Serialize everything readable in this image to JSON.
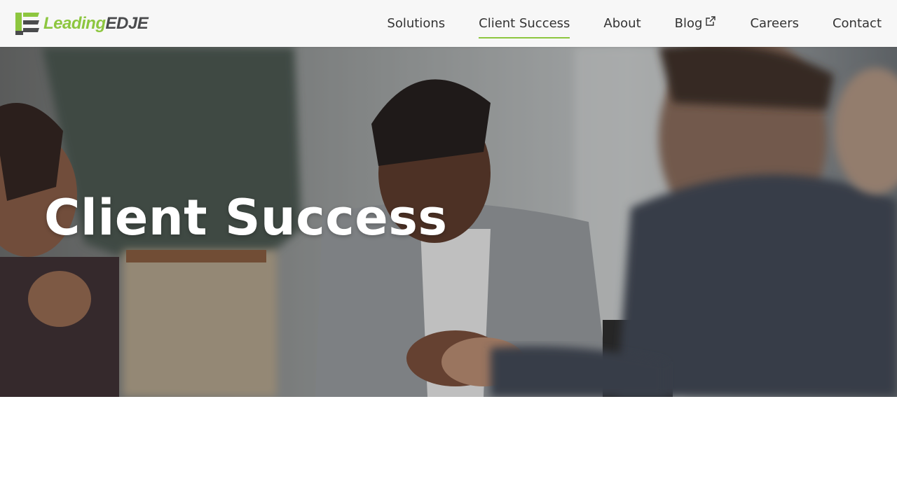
{
  "brand": {
    "name_part1": "Leading",
    "name_part2": "EDJE",
    "colors": {
      "green": "#8dc63f",
      "dark": "#4a4b4d"
    }
  },
  "nav": {
    "items": [
      {
        "label": "Solutions",
        "active": false
      },
      {
        "label": "Client Success",
        "active": true
      },
      {
        "label": "About",
        "active": false
      },
      {
        "label": "Blog",
        "active": false,
        "icon": "external-link-icon"
      },
      {
        "label": "Careers",
        "active": false
      },
      {
        "label": "Contact",
        "active": false
      }
    ]
  },
  "hero": {
    "title": "Client Success",
    "image": "business-handshake-photo"
  }
}
